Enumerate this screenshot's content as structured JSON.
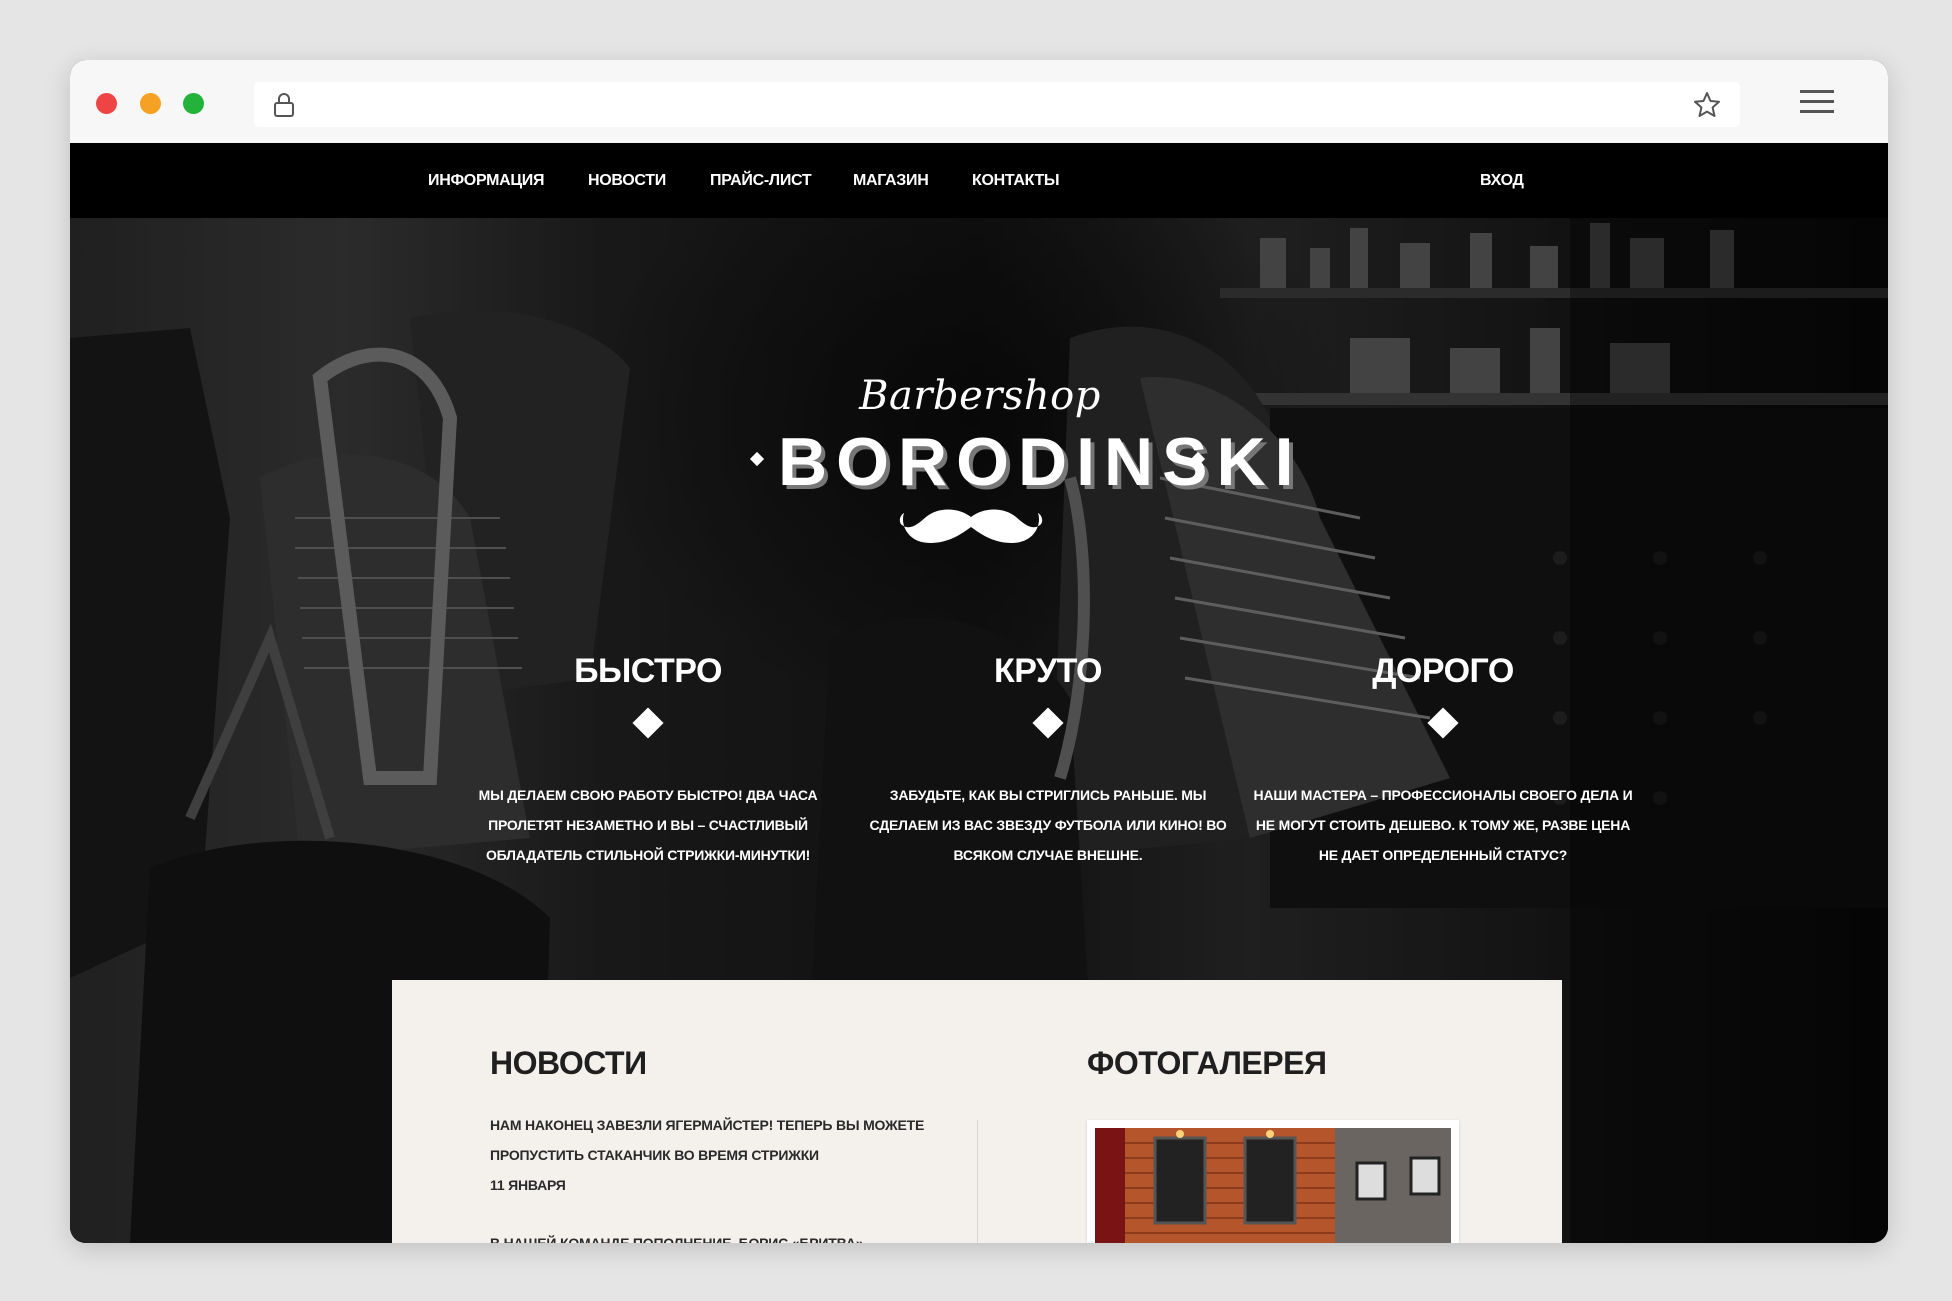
{
  "browser": {
    "controls": [
      "close",
      "minimize",
      "maximize"
    ],
    "url": "",
    "icons": [
      "lock-icon",
      "star-icon",
      "hamburger-menu-icon"
    ]
  },
  "nav": {
    "items": [
      {
        "label": "ИНФОРМАЦИЯ"
      },
      {
        "label": "НОВОСТИ"
      },
      {
        "label": "ПРАЙС-ЛИСТ"
      },
      {
        "label": "МАГАЗИН"
      },
      {
        "label": "КОНТАКТЫ"
      }
    ],
    "login": "ВХОД"
  },
  "logo": {
    "script": "Barbershop",
    "name": "BORODINSKI",
    "icon": "mustache-icon"
  },
  "features": [
    {
      "title": "БЫСТРО",
      "text": "МЫ ДЕЛАЕМ СВОЮ РАБОТУ БЫСТРО! ДВА ЧАСА ПРОЛЕТЯТ НЕЗАМЕТНО И ВЫ – СЧАСТЛИВЫЙ ОБЛАДАТЕЛЬ СТИЛЬНОЙ СТРИЖКИ-МИНУТКИ!"
    },
    {
      "title": "КРУТО",
      "text": "ЗАБУДЬТЕ, КАК ВЫ СТРИГЛИСЬ РАНЬШЕ. МЫ СДЕЛАЕМ ИЗ ВАС ЗВЕЗДУ ФУТБОЛА ИЛИ КИНО! ВО ВСЯКОМ СЛУЧАЕ ВНЕШНЕ."
    },
    {
      "title": "ДОРОГО",
      "text": "НАШИ МАСТЕРА – ПРОФЕССИОНАЛЫ СВОЕГО ДЕЛА И НЕ МОГУТ СТОИТЬ ДЕШЕВО. К ТОМУ ЖЕ, РАЗВЕ ЦЕНА НЕ ДАЕТ ОПРЕДЕЛЕННЫЙ СТАТУС?"
    }
  ],
  "news": {
    "title": "НОВОСТИ",
    "items": [
      {
        "text": "НАМ НАКОНЕЦ ЗАВЕЗЛИ ЯГЕРМАЙСТЕР! ТЕПЕРЬ ВЫ МОЖЕТЕ ПРОПУСТИТЬ СТАКАНЧИК ВО ВРЕМЯ СТРИЖКИ",
        "date": "11 ЯНВАРЯ"
      },
      {
        "text": "В НАШЕЙ КОМАНДЕ ПОПОЛНЕНИЕ, БОРИС «БРИТВА» СТРИГУНЕЦ, ОБЛАДАТЕЛЬ МНОЖЕСТВА ТИТУЛОВ И НАГРАД ПОПОЛНИЛ НАШИ СТРОЙНЫЕ РЯДЫ"
      }
    ]
  },
  "gallery": {
    "title": "ФОТОГАЛЕРЕЯ"
  }
}
